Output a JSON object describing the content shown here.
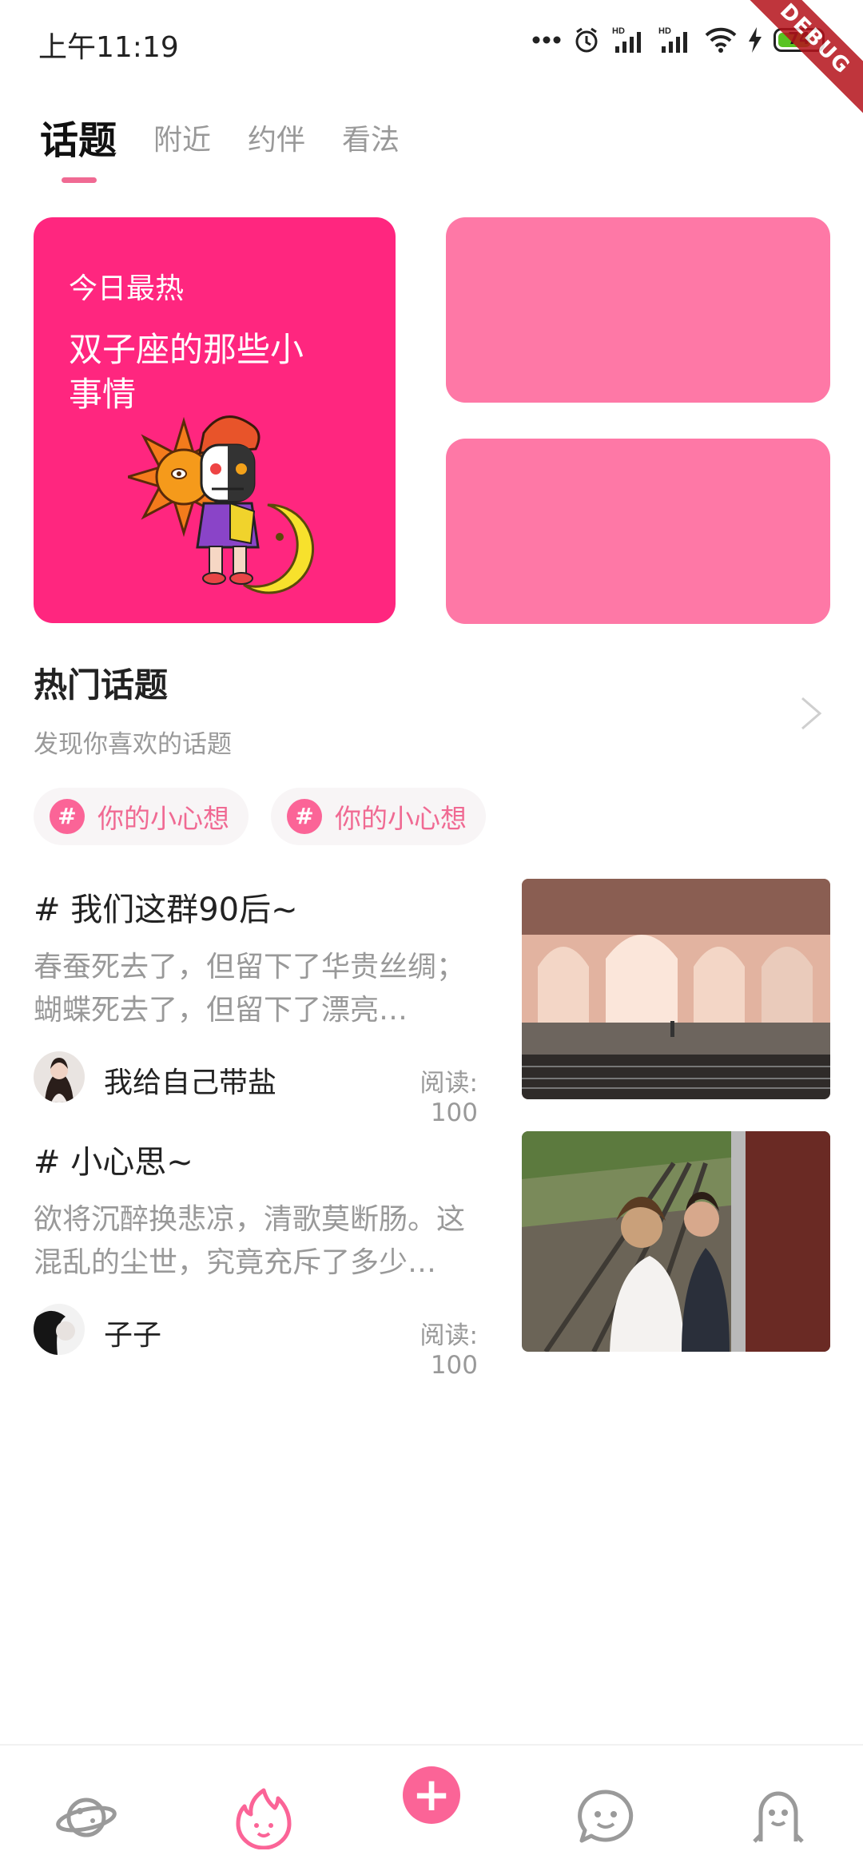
{
  "status_bar": {
    "time": "上午11:19",
    "battery": "74",
    "debug_label": "DEBUG"
  },
  "tabs": [
    {
      "label": "话题",
      "active": true
    },
    {
      "label": "附近",
      "active": false
    },
    {
      "label": "约伴",
      "active": false
    },
    {
      "label": "看法",
      "active": false
    }
  ],
  "featured": {
    "eyebrow": "今日最热",
    "title": "双子座的那些小事情",
    "accent": "#ff267f",
    "side_color": "#fe78a6"
  },
  "hot_topics": {
    "title": "热门话题",
    "subtitle": "发现你喜欢的话题",
    "chips": [
      {
        "hash": "#",
        "label": "你的小心想"
      },
      {
        "hash": "#",
        "label": "你的小心想"
      }
    ]
  },
  "feed": [
    {
      "title": "# 我们这群90后~",
      "desc": "春蚕死去了，但留下了华贵丝绸；蝴蝶死去了，但留下了漂亮…",
      "author": "我给自己带盐",
      "reads": "阅读: 100"
    },
    {
      "title": "# 小心思~",
      "desc": "欲将沉醉换悲凉，清歌莫断肠。这混乱的尘世，究竟充斥了多少…",
      "author": "子子",
      "reads": "阅读: 100"
    }
  ],
  "bottom_nav": {
    "items": [
      "planet-icon",
      "flame-icon",
      "add-icon",
      "chat-face-icon",
      "profile-icon"
    ],
    "plus": "+",
    "brand_color": "#fb6497"
  }
}
